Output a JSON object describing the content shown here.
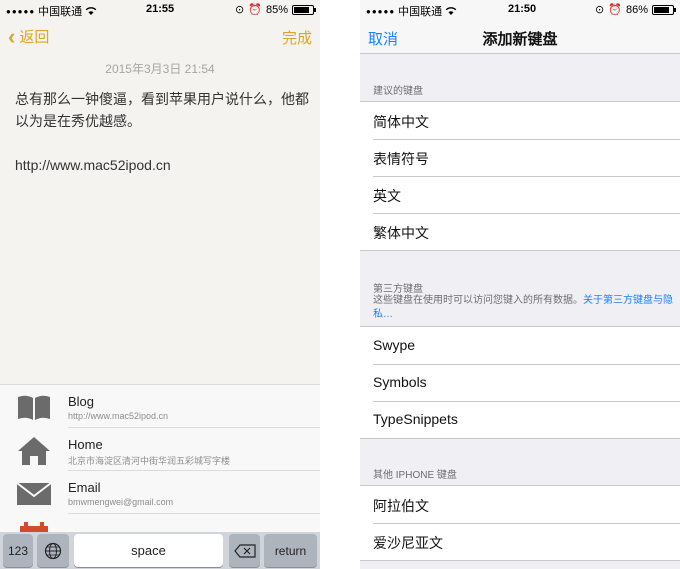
{
  "left": {
    "status": {
      "carrier": "中国联通",
      "time": "21:55",
      "battery": "85%",
      "battery_level": 0.85
    },
    "nav": {
      "back_label": "返回",
      "done_label": "完成"
    },
    "note": {
      "date": "2015年3月3日 21:54",
      "text": "总有那么一钟傻逼，看到苹果用户说什么，他都以为是在秀优越感。",
      "url": "http://www.mac52ipod.cn"
    },
    "suggestions": [
      {
        "icon": "book-icon",
        "title": "Blog",
        "subtitle": "http://www.mac52ipod.cn"
      },
      {
        "icon": "home-icon",
        "title": "Home",
        "subtitle": "北京市海淀区清河中街华润五彩城写字楼"
      },
      {
        "icon": "mail-icon",
        "title": "Email",
        "subtitle": "bmwmengwei@gmail.com"
      },
      {
        "icon": "calendar-icon",
        "title": "",
        "subtitle": ""
      }
    ],
    "keyboard": {
      "num_label": "123",
      "space_label": "space",
      "return_label": "return"
    }
  },
  "right": {
    "status": {
      "carrier": "中国联通",
      "time": "21:50",
      "battery": "86%",
      "battery_level": 0.86
    },
    "nav": {
      "cancel_label": "取消",
      "title": "添加新键盘"
    },
    "suggested_header": "建议的键盘",
    "suggested": [
      "简体中文",
      "表情符号",
      "英文",
      "繁体中文"
    ],
    "third_party_header": "第三方键盘",
    "third_party_note": "这些键盘在使用时可以访问您键入的所有数据。",
    "third_party_link": "关于第三方键盘与隐私…",
    "third_party": [
      "Swype",
      "Symbols",
      "TypeSnippets"
    ],
    "other_header": "其他 IPHONE 键盘",
    "other": [
      "阿拉伯文",
      "爱沙尼亚文"
    ]
  },
  "colors": {
    "notes_accent": "#e0a526",
    "ios_blue": "#1a82fb",
    "group_bg": "#efeff4"
  }
}
